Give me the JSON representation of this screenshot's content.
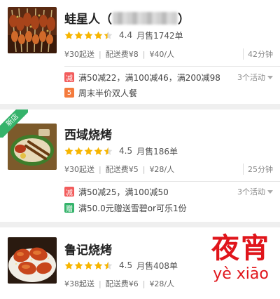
{
  "stores": [
    {
      "name": "蛙星人（",
      "name_suffix": "）",
      "rating": 4.4,
      "rating_text": "4.4",
      "sales": "月售1742单",
      "min_order": "¥30起送",
      "delivery_fee": "配送费¥8",
      "per_person": "¥40/人",
      "delivery_time": "42分钟",
      "activity_count": "3个活动",
      "promos": [
        {
          "tag": "减",
          "tag_color": "#f25c5c",
          "text": "满50减22，满100减46，满200减98"
        },
        {
          "tag": "5",
          "tag_color": "#f47b3d",
          "text": "周末半价双人餐"
        }
      ]
    },
    {
      "name": "西域烧烤",
      "badge": "新店",
      "rating": 4.5,
      "rating_text": "4.5",
      "sales": "月售186单",
      "min_order": "¥30起送",
      "delivery_fee": "配送费¥5",
      "per_person": "¥28/人",
      "delivery_time": "25分钟",
      "activity_count": "3个活动",
      "promos": [
        {
          "tag": "减",
          "tag_color": "#f25c5c",
          "text": "满50减25，满100减50"
        },
        {
          "tag": "赠",
          "tag_color": "#35b36b",
          "text": "满50.0元赠送雪碧or可乐1份"
        }
      ]
    },
    {
      "name": "鲁记烧烤",
      "rating": 4.5,
      "rating_text": "4.5",
      "sales": "月售408单",
      "min_order": "¥38起送",
      "delivery_fee": "配送费¥6",
      "per_person": "¥28/人"
    }
  ],
  "watermark": {
    "cn": "夜宵",
    "pinyin": "yè xiāo"
  },
  "colors": {
    "star": "#f7b500",
    "tag_red": "#f25c5c",
    "tag_orange": "#f47b3d",
    "tag_green": "#35b36b",
    "watermark": "#e0151b"
  }
}
